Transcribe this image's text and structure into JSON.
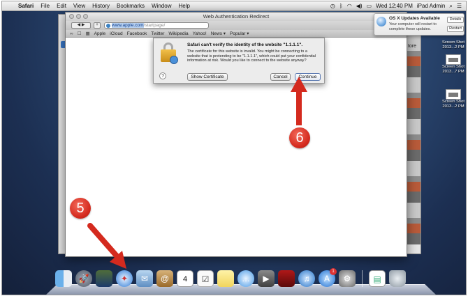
{
  "menubar": {
    "apple_symbol": "",
    "app_name": "Safari",
    "items": [
      "File",
      "Edit",
      "View",
      "History",
      "Bookmarks",
      "Window",
      "Help"
    ],
    "clock": "Wed 12:40 PM",
    "user": "iPad Admin"
  },
  "window": {
    "title": "Web Authentication Redirect",
    "url_host": "www.apple.com",
    "url_path": "/startpage/",
    "bookmarks": [
      "Apple",
      "iCloud",
      "Facebook",
      "Twitter",
      "Wikipedia",
      "Yahoo!",
      "News ▾",
      "Popular ▾"
    ]
  },
  "background_window": {
    "partial_label": "tore"
  },
  "dialog": {
    "title": "Safari can't verify the identity of the website \"1.1.1.1\".",
    "body": "The certificate for this website is invalid. You might be connecting to a website that is pretending to be \"1.1.1.1\", which could put your confidential information at risk. Would you like to connect to the website anyway?",
    "help_label": "?",
    "show_certificate_label": "Show Certificate",
    "cancel_label": "Cancel",
    "continue_label": "Continue"
  },
  "notification": {
    "title": "OS X Updates Available",
    "body": "Your computer will restart to complete these updates.",
    "details_label": "Details",
    "restart_label": "Restart"
  },
  "desktop_icons": [
    {
      "line1": "Screen Shot",
      "line2": "2013...2 PM"
    },
    {
      "line1": "Screen Shot",
      "line2": "2013...7 PM"
    },
    {
      "line1": "Screen Shot",
      "line2": "2013...2 PM"
    }
  ],
  "annotations": {
    "step5": "5",
    "step6": "6",
    "color": "#d42a1e"
  },
  "dock": {
    "calendar_day": "4",
    "app_store_badge": "1",
    "icons": [
      "finder-icon",
      "launchpad-icon",
      "mission-control-icon",
      "safari-icon",
      "mail-icon",
      "contacts-icon",
      "calendar-icon",
      "reminders-icon",
      "notes-icon",
      "messages-icon",
      "facetime-icon",
      "photo-booth-icon",
      "itunes-icon",
      "app-store-icon",
      "system-preferences-icon",
      "preview-icon",
      "trash-icon"
    ]
  }
}
